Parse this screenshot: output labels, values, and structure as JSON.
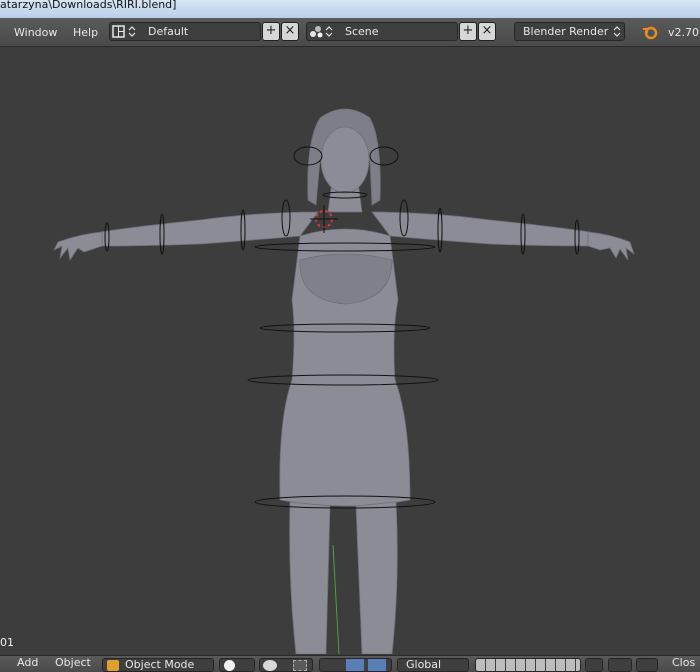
{
  "window": {
    "title": "atarzyna\\Downloads\\RIRI.blend]"
  },
  "topbar": {
    "menus": [
      "Window",
      "Help"
    ],
    "screen_layout": "Default",
    "scene": "Scene",
    "render_engine": "Blender Render",
    "version": "v2.70"
  },
  "viewport": {
    "frame_label": "01"
  },
  "bottombar": {
    "menus": [
      "Add",
      "Object"
    ],
    "mode": "Object Mode",
    "orientation": "Global",
    "right_label": "Clos"
  },
  "colors": {
    "background": "#3d3d3d",
    "header": "#4e4e4e",
    "model": "#8a8b94",
    "y_axis": "#4aa33b",
    "cursor": "#d23a3a"
  },
  "icons": [
    "screen-layout-icon",
    "add-icon",
    "close-icon",
    "scene-icon",
    "blender-logo-icon",
    "mode-cube-icon",
    "shading-sphere-icon",
    "pivot-icon",
    "manipulator-icon",
    "layers-icon"
  ]
}
